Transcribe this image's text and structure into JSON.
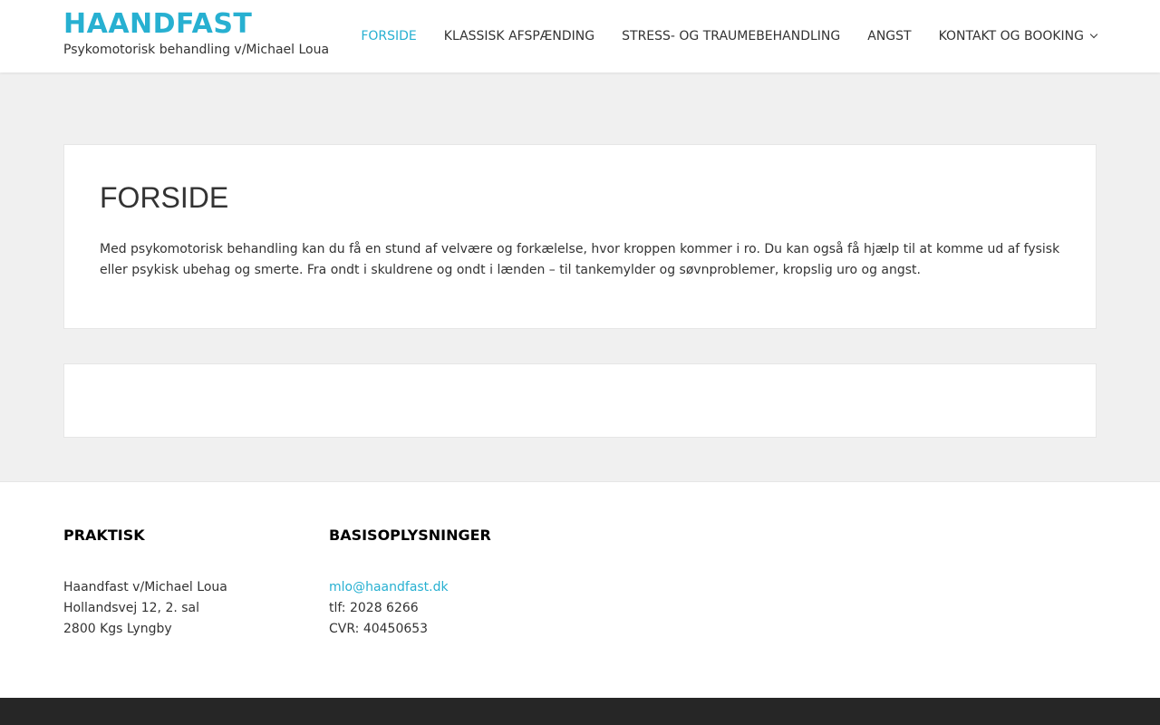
{
  "colors": {
    "accent": "#27b0d1",
    "background": "#f0f0f0",
    "footer_bar": "#262626"
  },
  "header": {
    "site_title": "HAANDFAST",
    "tagline": "Psykomotorisk behandling v/Michael Loua"
  },
  "nav": {
    "items": [
      {
        "label": "FORSIDE",
        "active": true
      },
      {
        "label": "KLASSISK AFSPÆNDING"
      },
      {
        "label": "STRESS- OG TRAUMEBEHANDLING"
      },
      {
        "label": "ANGST"
      },
      {
        "label": "KONTAKT OG BOOKING",
        "icon": "chevron-down-icon"
      }
    ]
  },
  "main": {
    "title": "FORSIDE",
    "intro": "Med psykomotorisk behandling kan du få en stund af velvære og forkælelse, hvor kroppen kommer i ro. Du kan også få hjælp til at komme ud af fysisk eller psykisk ubehag og smerte. Fra ondt i skuldrene og ondt i lænden – til tankemylder og søvnproblemer, kropslig uro og angst."
  },
  "footer": {
    "praktisk": {
      "title": "PRAKTISK",
      "lines": [
        "Haandfast v/Michael Loua",
        "Hollandsvej 12, 2. sal",
        "2800 Kgs Lyngby"
      ]
    },
    "basis": {
      "title": "BASISOPLYSNINGER",
      "email": "mlo@haandfast.dk",
      "phone": "tlf: 2028 6266",
      "cvr": "CVR: 40450653"
    }
  }
}
